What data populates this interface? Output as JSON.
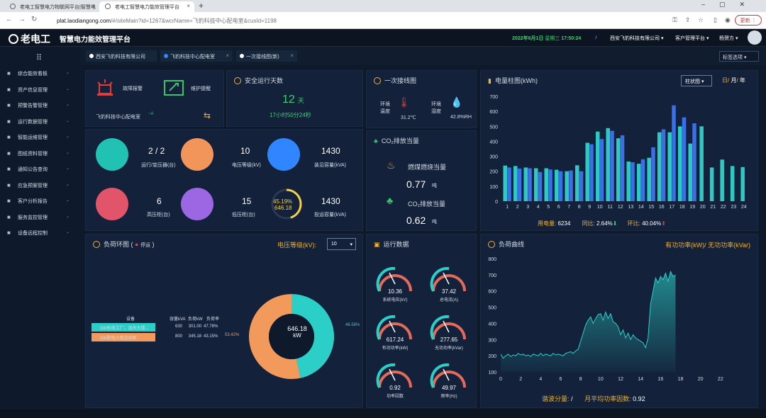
{
  "browser": {
    "tabs": [
      {
        "label": "老电工智慧电力物联网平台|智慧电"
      },
      {
        "label": "老电工智慧电力能效管理平台"
      }
    ],
    "url_host": "plat.laodiangong.com",
    "url_rest": "/#/siteMain?id=1267&wcrName=飞豹科技中心配电室&cusId=1198",
    "update_label": "更新"
  },
  "header": {
    "logo": "老电工",
    "platform": "智慧电力能效管理平台",
    "date": "2022年6月1日",
    "weekday": "星期三",
    "time": "17:50:24",
    "company": "西安飞豹科技有限公司",
    "customer_platform": "客户管理平台",
    "user": "杨贺方"
  },
  "sidebar": {
    "items": [
      {
        "label": "综合能效看板",
        "icon": "monitor-icon"
      },
      {
        "label": "资产信息管理",
        "icon": "asset-icon"
      },
      {
        "label": "预警告警管理",
        "icon": "alarm-icon"
      },
      {
        "label": "运行数据管理",
        "icon": "chart-icon"
      },
      {
        "label": "智能运维管理",
        "icon": "tool-icon"
      },
      {
        "label": "图纸资料管理",
        "icon": "drawing-icon"
      },
      {
        "label": "通知公告查询",
        "icon": "bell-icon"
      },
      {
        "label": "应急预案管理",
        "icon": "plan-icon"
      },
      {
        "label": "客户分析报告",
        "icon": "report-icon"
      },
      {
        "label": "服务监控管理",
        "icon": "service-icon"
      },
      {
        "label": "设备远程控制",
        "icon": "remote-icon"
      }
    ]
  },
  "page_tabs": [
    {
      "label": "西安飞豹科技有限公司",
      "dot": "#ffffff"
    },
    {
      "label": "飞豹科技中心配电室",
      "dot": "#2f86ff"
    },
    {
      "label": "一次接线图(新)",
      "dot": "#ffffff"
    }
  ],
  "tag_select": "标签选项",
  "alarm": {
    "fault_label": "故障报警",
    "maint_label": "维护提醒",
    "room": "飞豹科技中心配电室",
    "switch_label": "切换"
  },
  "safety": {
    "title": "安全运行天数",
    "days": "12",
    "days_unit": "天",
    "hms": "17小时50分24秒"
  },
  "stats": {
    "transformers": "2 / 2",
    "transformers_label": "运行/变压器(台)",
    "voltage_level": "10",
    "voltage_label": "电压等级(kV)",
    "capacity": "1430",
    "capacity_label": "装见容量(kVA)",
    "hv_cabinets": "6",
    "hv_label": "高压柜(台)",
    "lv_cabinets": "15",
    "lv_label": "低压柜(台)",
    "ring_pct": "45.19%",
    "ring_val": "646.18",
    "ring_fraction": 0.4519,
    "invest_capacity": "1430",
    "invest_label": "投运容量(kVA)"
  },
  "wiring": {
    "title": "一次接线图",
    "temp_label": "环境温度",
    "temp": "31.2℃",
    "hum_label": "环境湿度",
    "hum": "42.8%RH"
  },
  "co2": {
    "title": "CO₂排放当量",
    "coal_label": "燃煤燃烧当量",
    "coal_value": "0.77",
    "coal_unit": "吨",
    "co2_label": "CO₂排放当量",
    "co2_value": "0.62",
    "co2_unit": "吨"
  },
  "power_chart_panel": {
    "title": "电量柱图(kWh)",
    "select": "柱状图",
    "periods": [
      "日",
      "月",
      "年"
    ],
    "usage_label": "用电量:",
    "usage": "6234",
    "yoy_label": "同比:",
    "yoy": "2.64%",
    "mom_label": "环比:",
    "mom": "40.04%"
  },
  "load_ring": {
    "title": "负荷环图",
    "legend": "停运",
    "voltage_label": "电压等级(kV):",
    "voltage_value": "10",
    "center_value": "646.18",
    "center_unit": "kW",
    "pct_teal": "46.58%",
    "pct_orange": "53.42%",
    "table": {
      "headers": [
        "设备",
        "容量kVA",
        "负荷kW",
        "负荷率"
      ],
      "rows": [
        [
          "G6/机电工厂，加天大楼...",
          "630",
          "301.00",
          "47.78%"
        ],
        [
          "G8/配电大楼进线柜",
          "800",
          "345.18",
          "43.15%"
        ]
      ]
    },
    "colors": {
      "teal": "#2ccfc7",
      "orange": "#f19a5b"
    }
  },
  "run_data": {
    "title": "运行数据",
    "gauges": [
      {
        "value": "10.36",
        "label": "系统电压(kV)",
        "ticks": [
          "0",
          "11",
          "5",
          "10",
          "12"
        ]
      },
      {
        "value": "37.42",
        "label": "总电流(A)",
        "ticks": [
          "25",
          "50",
          "74",
          "0",
          "99"
        ]
      },
      {
        "value": "617.24",
        "label": "有功功率(kW)",
        "ticks": [
          "429",
          "1287",
          "0",
          "1716",
          "858"
        ]
      },
      {
        "value": "277.65",
        "label": "无功功率(kVar)",
        "ticks": [
          "358",
          "1073",
          "0",
          "1430",
          "715"
        ]
      },
      {
        "value": "0.92",
        "label": "功率因数",
        "ticks": [
          "0.25",
          "0.75",
          "0.00",
          "1.00",
          "0.50"
        ]
      },
      {
        "value": "49.97",
        "label": "频率(Hz)",
        "ticks": [
          "13",
          "38",
          "0",
          "51",
          "26"
        ]
      }
    ]
  },
  "load_curve": {
    "title": "负荷曲线",
    "legend": "有功功率(kW)/ 无功功率(kVar)",
    "harmonic_label": "谐波分量:",
    "harmonic_value": "/",
    "pf_label": "月平均功率因数:",
    "pf_value": "0.92"
  },
  "chart_data": [
    {
      "type": "bar",
      "title": "电量柱图(kWh)",
      "categories": [
        "1",
        "2",
        "3",
        "4",
        "5",
        "6",
        "7",
        "8",
        "9",
        "10",
        "11",
        "12",
        "13",
        "14",
        "15",
        "16",
        "17",
        "18",
        "19",
        "20",
        "21",
        "22",
        "23",
        "24"
      ],
      "series": [
        {
          "values": [
            238,
            235,
            225,
            220,
            220,
            210,
            200,
            240,
            390,
            465,
            488,
            420,
            265,
            250,
            290,
            460,
            460,
            500,
            385,
            500,
            225,
            278,
            235,
            228
          ]
        },
        {
          "values": [
            225,
            218,
            220,
            195,
            212,
            200,
            205,
            200,
            380,
            415,
            470,
            440,
            260,
            280,
            360,
            480,
            640,
            560,
            520,
            null,
            null,
            null,
            null,
            null
          ]
        }
      ],
      "colors": [
        "#2ec9c3",
        "#3a6fe8"
      ],
      "ylim": [
        0,
        700
      ],
      "yticks": [
        0,
        100,
        200,
        300,
        400,
        500,
        600,
        700
      ]
    },
    {
      "type": "area",
      "title": "负荷曲线",
      "xlim": [
        0,
        24
      ],
      "xticks": [
        0,
        2,
        4,
        6,
        8,
        10,
        12,
        14,
        16,
        18,
        20,
        22
      ],
      "ylim": [
        100,
        800
      ],
      "yticks": [
        100,
        200,
        300,
        400,
        500,
        600,
        700,
        800
      ],
      "x": [
        0,
        0.25,
        0.5,
        0.75,
        1,
        1.25,
        1.5,
        1.75,
        2,
        2.25,
        2.5,
        2.75,
        3,
        3.25,
        3.5,
        3.75,
        4,
        4.25,
        4.5,
        4.75,
        5,
        5.25,
        5.5,
        5.75,
        6,
        6.25,
        6.5,
        6.75,
        7,
        7.25,
        7.5,
        7.75,
        8,
        8.25,
        8.5,
        8.75,
        9,
        9.25,
        9.5,
        9.75,
        10,
        10.25,
        10.5,
        10.75,
        11,
        11.25,
        11.5,
        11.75,
        12,
        12.25,
        12.5,
        12.75,
        13,
        13.25,
        13.5,
        13.75,
        14,
        14.25,
        14.5,
        14.75,
        15,
        15.25,
        15.5,
        15.75,
        16,
        16.25,
        16.5,
        16.75,
        17,
        17.25,
        17.5
      ],
      "y": [
        210,
        185,
        200,
        210,
        195,
        205,
        200,
        215,
        205,
        210,
        200,
        205,
        195,
        210,
        205,
        200,
        215,
        200,
        210,
        205,
        200,
        215,
        205,
        210,
        205,
        200,
        215,
        220,
        225,
        215,
        230,
        240,
        290,
        340,
        390,
        420,
        440,
        400,
        430,
        455,
        460,
        420,
        470,
        430,
        460,
        410,
        400,
        380,
        330,
        360,
        310,
        340,
        300,
        330,
        310,
        300,
        290,
        280,
        250,
        310,
        520,
        600,
        680,
        650,
        690,
        670,
        710,
        660,
        720,
        690,
        700
      ]
    }
  ]
}
